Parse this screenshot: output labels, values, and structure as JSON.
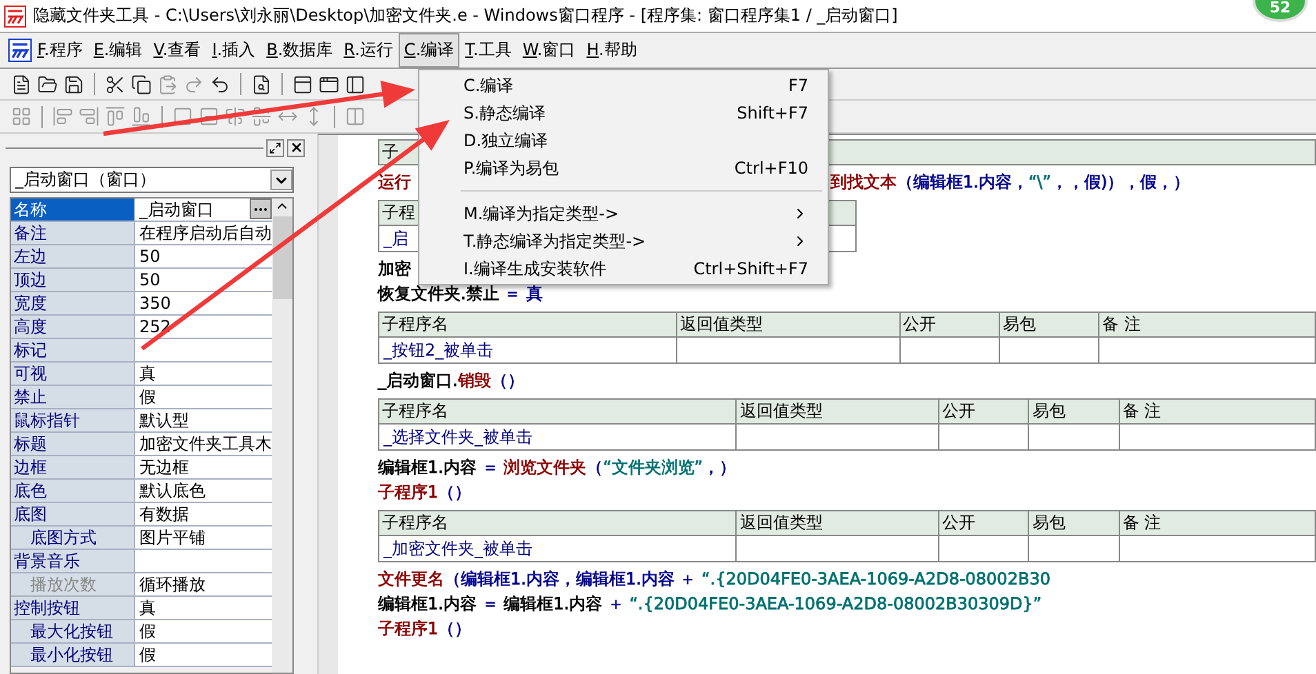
{
  "window": {
    "title": "隐藏文件夹工具 - C:\\Users\\刘永丽\\Desktop\\加密文件夹.e - Windows窗口程序 - [程序集: 窗口程序集1 / _启动窗口]"
  },
  "notification_badge": {
    "count": "52"
  },
  "menu_bar": [
    {
      "label": "F.程序",
      "selected": false
    },
    {
      "label": "E.编辑",
      "selected": false
    },
    {
      "label": "V.查看",
      "selected": false
    },
    {
      "label": "I.插入",
      "selected": false
    },
    {
      "label": "B.数据库",
      "selected": false
    },
    {
      "label": "R.运行",
      "selected": false
    },
    {
      "label": "C.编译",
      "selected": true
    },
    {
      "label": "T.工具",
      "selected": false
    },
    {
      "label": "W.窗口",
      "selected": false
    },
    {
      "label": "H.帮助",
      "selected": false
    }
  ],
  "compile_menu": [
    {
      "kind": "item",
      "label": "C.编译",
      "shortcut": "F7"
    },
    {
      "kind": "item",
      "label": "S.静态编译",
      "shortcut": "Shift+F7"
    },
    {
      "kind": "item",
      "label": "D.独立编译"
    },
    {
      "kind": "item",
      "label": "P.编译为易包",
      "shortcut": "Ctrl+F10"
    },
    {
      "kind": "separator"
    },
    {
      "kind": "submenu",
      "label": "M.编译为指定类型->"
    },
    {
      "kind": "submenu",
      "label": "T.静态编译为指定类型->"
    },
    {
      "kind": "item",
      "label": "I.编译生成安装软件",
      "shortcut": "Ctrl+Shift+F7"
    }
  ],
  "properties_panel": {
    "object_selector": "_启动窗口（窗口）",
    "rows": [
      {
        "name": "名称",
        "value": "_启动窗口",
        "selected": true,
        "disabled": false
      },
      {
        "name": "备注",
        "value": "在程序启动后自动",
        "selected": false,
        "disabled": false
      },
      {
        "name": "左边",
        "value": "50",
        "selected": false,
        "disabled": false
      },
      {
        "name": "顶边",
        "value": "50",
        "selected": false,
        "disabled": false
      },
      {
        "name": "宽度",
        "value": "350",
        "selected": false,
        "disabled": false
      },
      {
        "name": "高度",
        "value": "252",
        "selected": false,
        "disabled": false
      },
      {
        "name": "标记",
        "selected": false,
        "disabled": false
      },
      {
        "name": "可视",
        "value": "真",
        "selected": false,
        "disabled": false
      },
      {
        "name": "禁止",
        "value": "假",
        "selected": false,
        "disabled": false
      },
      {
        "name": "鼠标指针",
        "value": "默认型",
        "selected": false,
        "disabled": false
      },
      {
        "name": "标题",
        "value": "加密文件夹工具木",
        "selected": false,
        "disabled": false
      },
      {
        "name": "边框",
        "value": "无边框",
        "selected": false,
        "disabled": false
      },
      {
        "name": "底色",
        "value": "默认底色",
        "selected": false,
        "disabled": false
      },
      {
        "name": "底图",
        "value": "有数据",
        "selected": false,
        "disabled": false,
        "children": [
          {
            "name": "底图方式",
            "value": "图片平铺",
            "selected": false,
            "disabled": false
          }
        ]
      },
      {
        "name": "背景音乐",
        "selected": false,
        "disabled": false,
        "children": [
          {
            "name": "播放次数",
            "value": "循环播放",
            "selected": false,
            "disabled": true
          }
        ]
      },
      {
        "name": "控制按钮",
        "value": "真",
        "selected": false,
        "disabled": false,
        "children": [
          {
            "name": "最大化按钮",
            "value": "假",
            "selected": false,
            "disabled": false
          },
          {
            "name": "最小化按钮",
            "value": "假",
            "selected": false,
            "disabled": false
          }
        ]
      }
    ]
  },
  "code_editor": {
    "blocks": [
      {
        "kind": "table",
        "columns": [
          "子"
        ]
      },
      {
        "kind": "split_line",
        "segments": [
          {
            "text": "运行",
            "color": "#8b0000"
          }
        ],
        "tail": [
          {
            "text": "到找文本",
            "color": "#8b0000"
          },
          {
            "text": "（编辑框1.内容，",
            "color": "#00008b"
          },
          {
            "text": "“\\”",
            "color": "#007070"
          },
          {
            "text": "，，假)），假，）",
            "color": "#00008b"
          }
        ]
      },
      {
        "kind": "table",
        "columns": [
          "子程"
        ],
        "cells": [
          "_启"
        ]
      },
      {
        "kind": "line",
        "segments": [
          {
            "text": "加密",
            "color": "#000000"
          }
        ]
      },
      {
        "kind": "line",
        "segments": [
          {
            "text": "恢复文件夹.禁止",
            "color": "#000000"
          },
          {
            "text": " ＝ 真",
            "color": "#00008b"
          }
        ]
      },
      {
        "kind": "table",
        "columns": [
          "子程序名",
          "返回值类型",
          "公开",
          "易包",
          "备 注"
        ],
        "cells": [
          "_按钮2_被单击"
        ]
      },
      {
        "kind": "line",
        "segments": [
          {
            "text": "_启动窗口.",
            "color": "#000000"
          },
          {
            "text": "销毁",
            "color": "#8b0000"
          },
          {
            "text": "（）",
            "color": "#00008b"
          }
        ]
      },
      {
        "kind": "table",
        "columns": [
          "子程序名",
          "返回值类型",
          "公开",
          "易包",
          "备 注"
        ],
        "cells": [
          "_选择文件夹_被单击"
        ]
      },
      {
        "kind": "line",
        "segments": [
          {
            "text": "编辑框1.内容",
            "color": "#000000"
          },
          {
            "text": " ＝ ",
            "color": "#00008b"
          },
          {
            "text": "浏览文件夹",
            "color": "#8b0000"
          },
          {
            "text": "（",
            "color": "#00008b"
          },
          {
            "text": "“文件夹浏览”",
            "color": "#007070"
          },
          {
            "text": "，）",
            "color": "#00008b"
          }
        ]
      },
      {
        "kind": "line",
        "segments": [
          {
            "text": "子程序1",
            "color": "#8b0000"
          },
          {
            "text": "（）",
            "color": "#00008b"
          }
        ]
      },
      {
        "kind": "table",
        "columns": [
          "子程序名",
          "返回值类型",
          "公开",
          "易包",
          "备 注"
        ],
        "cells": [
          "_加密文件夹_被单击"
        ]
      },
      {
        "kind": "line",
        "segments": [
          {
            "text": "文件更名",
            "color": "#8b0000"
          },
          {
            "text": "（编辑框1.内容，编辑框1.内容 ＋ ",
            "color": "#00008b"
          },
          {
            "text": "“.{20D04FE0-3AEA-1069-A2D8-08002B30",
            "color": "#007070"
          }
        ]
      },
      {
        "kind": "line",
        "segments": [
          {
            "text": "编辑框1.内容",
            "color": "#000000"
          },
          {
            "text": " ＝ ",
            "color": "#00008b"
          },
          {
            "text": "编辑框1.内容",
            "color": "#000000"
          },
          {
            "text": " ＋ ",
            "color": "#00008b"
          },
          {
            "text": "“.{20D04FE0-3AEA-1069-A2D8-08002B30309D}”",
            "color": "#007070"
          }
        ]
      },
      {
        "kind": "line",
        "segments": [
          {
            "text": "子程序1",
            "color": "#8b0000"
          },
          {
            "text": "（）",
            "color": "#00008b"
          }
        ]
      }
    ]
  }
}
